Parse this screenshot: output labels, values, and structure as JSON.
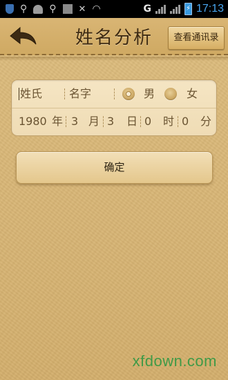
{
  "status_bar": {
    "time": "17:13",
    "network": "G",
    "battery": "⚡"
  },
  "header": {
    "title": "姓名分析",
    "contacts_button": "查看通讯录"
  },
  "form": {
    "surname_placeholder": "姓氏",
    "name_placeholder": "名字",
    "gender_male": "男",
    "gender_female": "女",
    "selected_gender": "男",
    "year": "1980",
    "year_unit": "年",
    "month": "3",
    "month_unit": "月",
    "day": "3",
    "day_unit": "日",
    "hour": "0",
    "hour_unit": "时",
    "minute": "0",
    "minute_unit": "分"
  },
  "actions": {
    "confirm_label": "确定"
  },
  "watermark": "xfdown.com",
  "colors": {
    "background": "#d9b777",
    "title_text": "#3e2a12",
    "watermark": "#3f9a47",
    "status_time": "#49a6f0"
  }
}
